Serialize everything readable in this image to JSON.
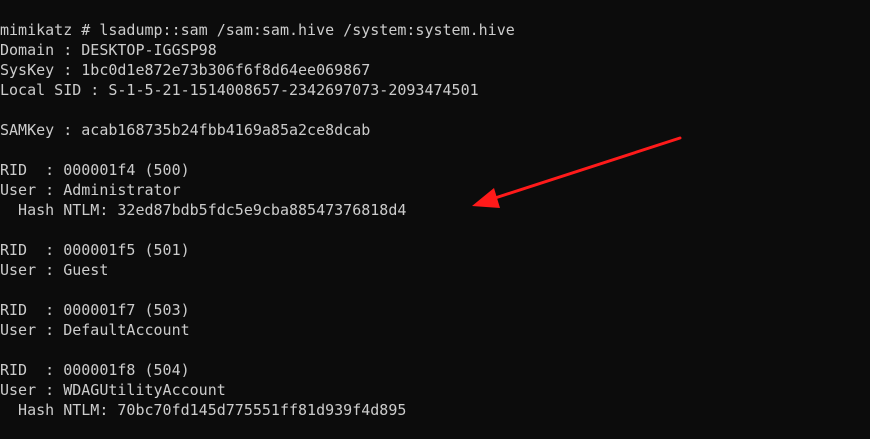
{
  "terminal": {
    "lines": [
      "mimikatz # lsadump::sam /sam:sam.hive /system:system.hive",
      "Domain : DESKTOP-IGGSP98",
      "SysKey : 1bc0d1e872e73b306f6f8d64ee069867",
      "Local SID : S-1-5-21-1514008657-2342697073-2093474501",
      "",
      "SAMKey : acab168735b24fbb4169a85a2ce8dcab",
      "",
      "RID  : 000001f4 (500)",
      "User : Administrator",
      "  Hash NTLM: 32ed87bdb5fdc5e9cba88547376818d4",
      "",
      "RID  : 000001f5 (501)",
      "User : Guest",
      "",
      "RID  : 000001f7 (503)",
      "User : DefaultAccount",
      "",
      "RID  : 000001f8 (504)",
      "User : WDAGUtilityAccount",
      "  Hash NTLM: 70bc70fd145d775551ff81d939f4d895"
    ]
  },
  "colors": {
    "background": "#0c0c0c",
    "text": "#cccccc",
    "arrow": "#ff1a1a"
  },
  "annotation": {
    "icon": "red-arrow-icon"
  }
}
